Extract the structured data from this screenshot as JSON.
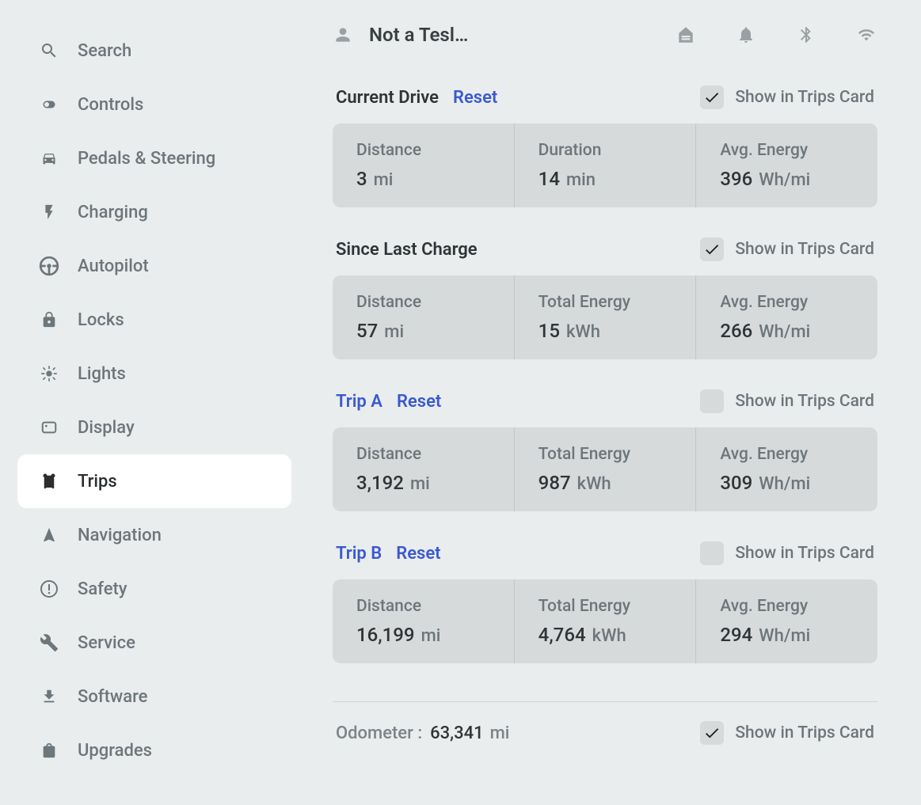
{
  "sidebar": {
    "items": [
      {
        "label": "Search"
      },
      {
        "label": "Controls"
      },
      {
        "label": "Pedals & Steering"
      },
      {
        "label": "Charging"
      },
      {
        "label": "Autopilot"
      },
      {
        "label": "Locks"
      },
      {
        "label": "Lights"
      },
      {
        "label": "Display"
      },
      {
        "label": "Trips"
      },
      {
        "label": "Navigation"
      },
      {
        "label": "Safety"
      },
      {
        "label": "Service"
      },
      {
        "label": "Software"
      },
      {
        "label": "Upgrades"
      }
    ],
    "active_index": 8
  },
  "topbar": {
    "profile_name": "Not a Tesl…"
  },
  "labels": {
    "reset": "Reset",
    "show_in_card": "Show in Trips Card",
    "distance": "Distance",
    "duration": "Duration",
    "avg_energy": "Avg. Energy",
    "total_energy": "Total Energy",
    "odometer": "Odometer  :"
  },
  "sections": [
    {
      "title": "Current Drive",
      "title_link": false,
      "has_reset": true,
      "checked": true,
      "stats": [
        {
          "label_key": "distance",
          "value": "3",
          "unit": "mi"
        },
        {
          "label_key": "duration",
          "value": "14",
          "unit": "min"
        },
        {
          "label_key": "avg_energy",
          "value": "396",
          "unit": "Wh/mi"
        }
      ]
    },
    {
      "title": "Since Last Charge",
      "title_link": false,
      "has_reset": false,
      "checked": true,
      "stats": [
        {
          "label_key": "distance",
          "value": "57",
          "unit": "mi"
        },
        {
          "label_key": "total_energy",
          "value": "15",
          "unit": "kWh"
        },
        {
          "label_key": "avg_energy",
          "value": "266",
          "unit": "Wh/mi"
        }
      ]
    },
    {
      "title": "Trip A",
      "title_link": true,
      "has_reset": true,
      "checked": false,
      "stats": [
        {
          "label_key": "distance",
          "value": "3,192",
          "unit": "mi"
        },
        {
          "label_key": "total_energy",
          "value": "987",
          "unit": "kWh"
        },
        {
          "label_key": "avg_energy",
          "value": "309",
          "unit": "Wh/mi"
        }
      ]
    },
    {
      "title": "Trip B",
      "title_link": true,
      "has_reset": true,
      "checked": false,
      "stats": [
        {
          "label_key": "distance",
          "value": "16,199",
          "unit": "mi"
        },
        {
          "label_key": "total_energy",
          "value": "4,764",
          "unit": "kWh"
        },
        {
          "label_key": "avg_energy",
          "value": "294",
          "unit": "Wh/mi"
        }
      ]
    }
  ],
  "odometer": {
    "value": "63,341",
    "unit": "mi",
    "checked": true
  }
}
